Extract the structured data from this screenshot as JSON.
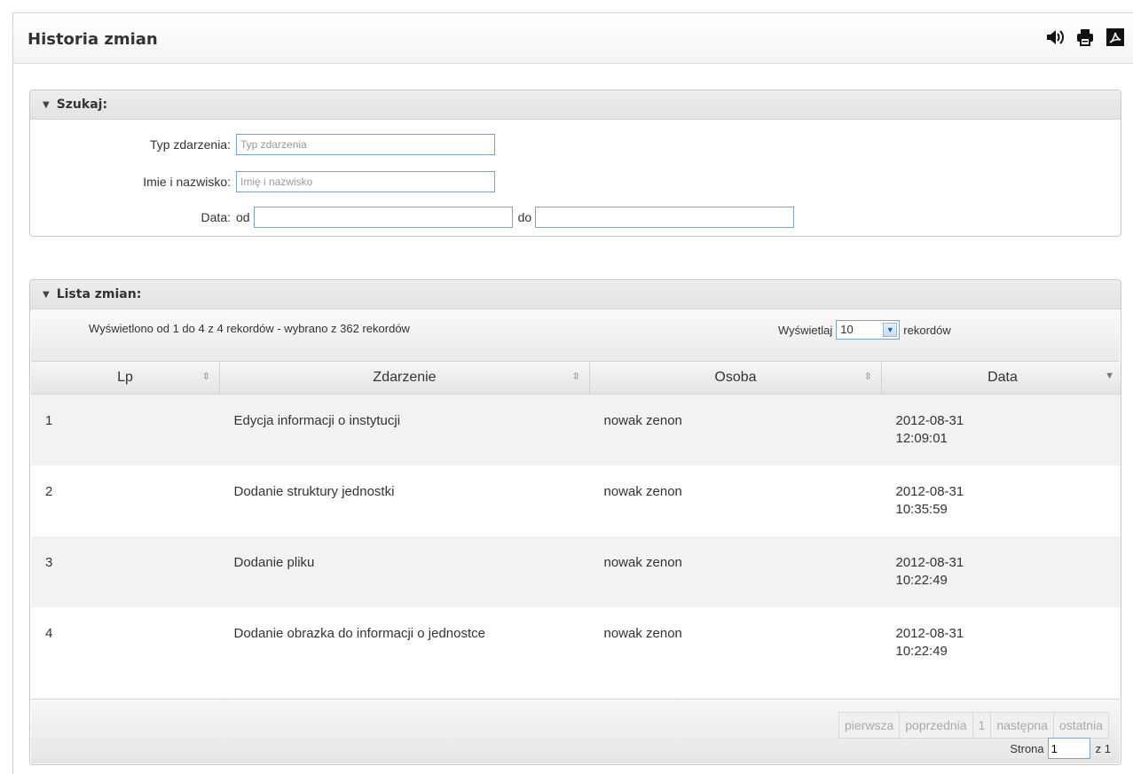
{
  "header": {
    "title": "Historia zmian",
    "icons": [
      "speaker-icon",
      "printer-icon",
      "pdf-icon"
    ]
  },
  "search": {
    "title": "Szukaj:",
    "event_type": {
      "label": "Typ zdarzenia:",
      "placeholder": "Typ zdarzenia",
      "value": ""
    },
    "person": {
      "label": "Imie i nazwisko:",
      "placeholder": "Imię i nazwisko",
      "value": ""
    },
    "date": {
      "label": "Data:",
      "from_label": "od",
      "to_label": "do",
      "from_value": "",
      "to_value": ""
    }
  },
  "list": {
    "title": "Lista zmian:",
    "info": "Wyświetlono od 1 do 4 z 4 rekordów - wybrano z 362 rekordów",
    "show_label": "Wyświetlaj",
    "page_size": "10",
    "records_label": "rekordów",
    "columns": [
      "Lp",
      "Zdarzenie",
      "Osoba",
      "Data"
    ],
    "rows": [
      {
        "lp": "1",
        "event": "Edycja informacji o instytucji",
        "person": "nowak zenon",
        "date": "2012-08-31",
        "time": "12:09:01"
      },
      {
        "lp": "2",
        "event": "Dodanie struktury jednostki",
        "person": "nowak zenon",
        "date": "2012-08-31",
        "time": "10:35:59"
      },
      {
        "lp": "3",
        "event": "Dodanie pliku",
        "person": "nowak zenon",
        "date": "2012-08-31",
        "time": "10:22:49"
      },
      {
        "lp": "4",
        "event": "Dodanie obrazka do informacji o jednostce",
        "person": "nowak zenon",
        "date": "2012-08-31",
        "time": "10:22:49"
      }
    ],
    "pager": {
      "first": "pierwsza",
      "prev": "poprzednia",
      "current": "1",
      "next": "następna",
      "last": "ostatnia",
      "page_label": "Strona",
      "page_value": "1",
      "of_label": "z 1"
    }
  }
}
